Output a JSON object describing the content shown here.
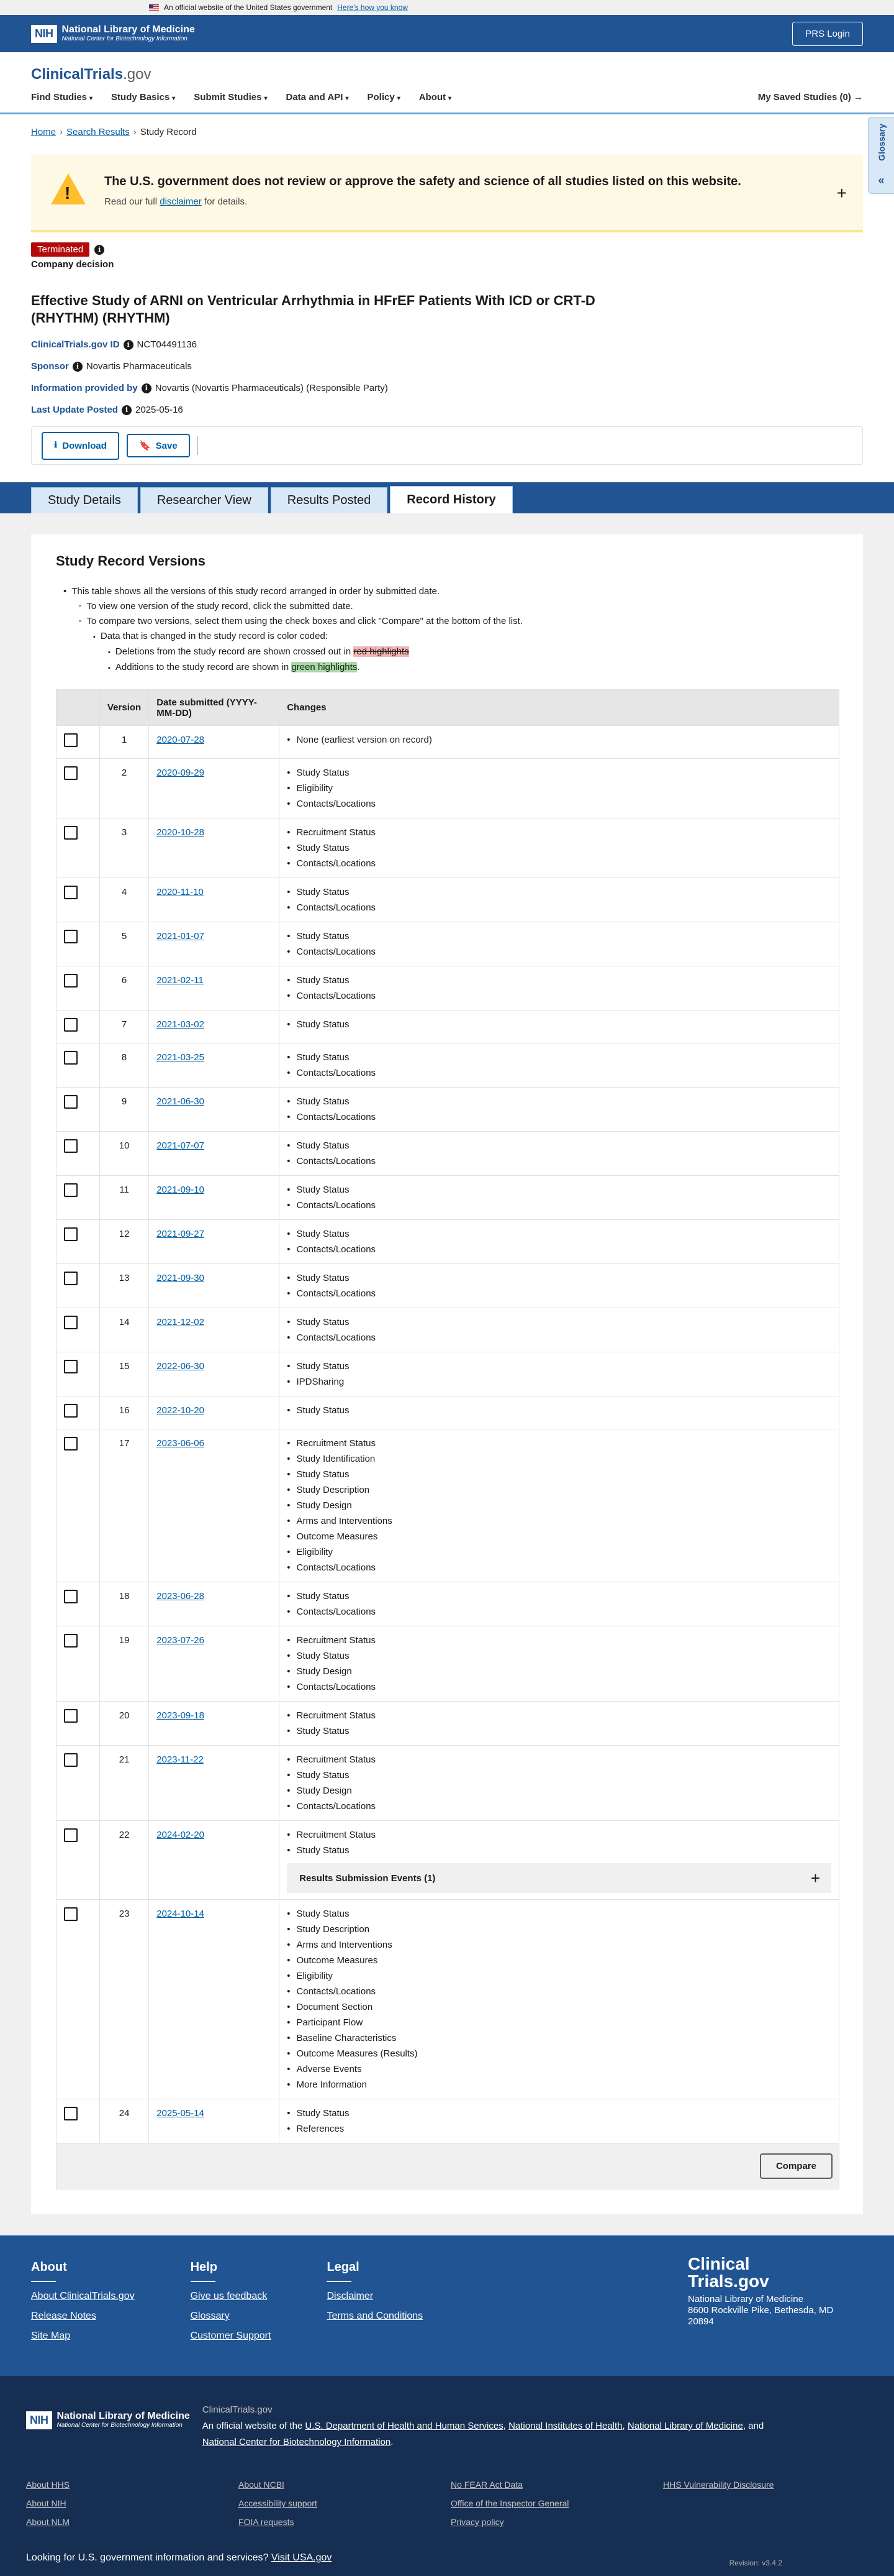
{
  "gov_banner": {
    "text": "An official website of the United States government",
    "link": "Here's how you know"
  },
  "nlm": {
    "nih_box": "NIH",
    "title": "National Library of Medicine",
    "subtitle": "National Center for Biotechnology Information",
    "prs_login": "PRS Login"
  },
  "site": {
    "logo_main": "ClinicalTrials",
    "logo_suffix": ".gov"
  },
  "nav": {
    "items": [
      "Find Studies",
      "Study Basics",
      "Submit Studies",
      "Data and API",
      "Policy",
      "About"
    ],
    "saved": "My Saved Studies (0) →"
  },
  "glossary": {
    "label": "Glossary"
  },
  "breadcrumb": {
    "home": "Home",
    "search": "Search Results",
    "current": "Study Record"
  },
  "alert": {
    "heading": "The U.S. government does not review or approve the safety and science of all studies listed on this website.",
    "pre": "Read our full",
    "link": "disclaimer",
    "post": "for details."
  },
  "status": {
    "badge": "Terminated",
    "company": "Company decision"
  },
  "study": {
    "title": "Effective Study of ARNI on Ventricular Arrhythmia in HFrEF Patients With ICD or CRT-D (RHYTHM) (RHYTHM)",
    "id_label": "ClinicalTrials.gov ID",
    "id_value": "NCT04491136",
    "sponsor_label": "Sponsor",
    "sponsor_value": "Novartis Pharmaceuticals",
    "info_label": "Information provided by",
    "info_value": "Novartis (Novartis Pharmaceuticals) (Responsible Party)",
    "update_label": "Last Update Posted",
    "update_value": "2025-05-16"
  },
  "actions": {
    "download": "Download",
    "save": "Save"
  },
  "tabs": [
    "Study Details",
    "Researcher View",
    "Results Posted",
    "Record History"
  ],
  "history": {
    "heading": "Study Record Versions",
    "i1": "This table shows all the versions of this study record arranged in order by submitted date.",
    "i2": "To view one version of the study record, click the submitted date.",
    "i3": "To compare two versions, select them using the check boxes and click \"Compare\" at the bottom of the list.",
    "i4": "Data that is changed in the study record is color coded:",
    "i5_pre": "Deletions from the study record are shown crossed out in",
    "i5_hl": "red highlights",
    "i6_pre": "Additions to the study record are shown in",
    "i6_hl": "green highlights",
    "col_version": "Version",
    "col_date": "Date submitted (YYYY-MM-DD)",
    "col_changes": "Changes",
    "rse_label": "Results Submission Events (1)",
    "compare": "Compare",
    "rows": [
      {
        "v": "1",
        "d": "2020-07-28",
        "c": [
          "None (earliest version on record)"
        ]
      },
      {
        "v": "2",
        "d": "2020-09-29",
        "c": [
          "Study Status",
          "Eligibility",
          "Contacts/Locations"
        ]
      },
      {
        "v": "3",
        "d": "2020-10-28",
        "c": [
          "Recruitment Status",
          "Study Status",
          "Contacts/Locations"
        ]
      },
      {
        "v": "4",
        "d": "2020-11-10",
        "c": [
          "Study Status",
          "Contacts/Locations"
        ]
      },
      {
        "v": "5",
        "d": "2021-01-07",
        "c": [
          "Study Status",
          "Contacts/Locations"
        ]
      },
      {
        "v": "6",
        "d": "2021-02-11",
        "c": [
          "Study Status",
          "Contacts/Locations"
        ]
      },
      {
        "v": "7",
        "d": "2021-03-02",
        "c": [
          "Study Status"
        ]
      },
      {
        "v": "8",
        "d": "2021-03-25",
        "c": [
          "Study Status",
          "Contacts/Locations"
        ]
      },
      {
        "v": "9",
        "d": "2021-06-30",
        "c": [
          "Study Status",
          "Contacts/Locations"
        ]
      },
      {
        "v": "10",
        "d": "2021-07-07",
        "c": [
          "Study Status",
          "Contacts/Locations"
        ]
      },
      {
        "v": "11",
        "d": "2021-09-10",
        "c": [
          "Study Status",
          "Contacts/Locations"
        ]
      },
      {
        "v": "12",
        "d": "2021-09-27",
        "c": [
          "Study Status",
          "Contacts/Locations"
        ]
      },
      {
        "v": "13",
        "d": "2021-09-30",
        "c": [
          "Study Status",
          "Contacts/Locations"
        ]
      },
      {
        "v": "14",
        "d": "2021-12-02",
        "c": [
          "Study Status",
          "Contacts/Locations"
        ]
      },
      {
        "v": "15",
        "d": "2022-06-30",
        "c": [
          "Study Status",
          "IPDSharing"
        ]
      },
      {
        "v": "16",
        "d": "2022-10-20",
        "c": [
          "Study Status"
        ]
      },
      {
        "v": "17",
        "d": "2023-06-06",
        "c": [
          "Recruitment Status",
          "Study Identification",
          "Study Status",
          "Study Description",
          "Study Design",
          "Arms and Interventions",
          "Outcome Measures",
          "Eligibility",
          "Contacts/Locations"
        ]
      },
      {
        "v": "18",
        "d": "2023-06-28",
        "c": [
          "Study Status",
          "Contacts/Locations"
        ]
      },
      {
        "v": "19",
        "d": "2023-07-26",
        "c": [
          "Recruitment Status",
          "Study Status",
          "Study Design",
          "Contacts/Locations"
        ]
      },
      {
        "v": "20",
        "d": "2023-09-18",
        "c": [
          "Recruitment Status",
          "Study Status"
        ]
      },
      {
        "v": "21",
        "d": "2023-11-22",
        "c": [
          "Recruitment Status",
          "Study Status",
          "Study Design",
          "Contacts/Locations"
        ]
      },
      {
        "v": "22",
        "d": "2024-02-20",
        "c": [
          "Recruitment Status",
          "Study Status"
        ],
        "rse": true
      },
      {
        "v": "23",
        "d": "2024-10-14",
        "c": [
          "Study Status",
          "Study Description",
          "Arms and Interventions",
          "Outcome Measures",
          "Eligibility",
          "Contacts/Locations",
          "Document Section",
          "Participant Flow",
          "Baseline Characteristics",
          "Outcome Measures (Results)",
          "Adverse Events",
          "More Information"
        ]
      },
      {
        "v": "24",
        "d": "2025-05-14",
        "c": [
          "Study Status",
          "References"
        ]
      }
    ]
  },
  "footer": {
    "about_h": "About",
    "about_links": [
      "About ClinicalTrials.gov",
      "Release Notes",
      "Site Map"
    ],
    "help_h": "Help",
    "help_links": [
      "Give us feedback",
      "Glossary",
      "Customer Support"
    ],
    "legal_h": "Legal",
    "legal_links": [
      "Disclaimer",
      "Terms and Conditions"
    ],
    "brand": "Clinical Trials.gov",
    "addr1": "National Library of Medicine",
    "addr2": "8600 Rockville Pike, Bethesda, MD 20894",
    "ct_label": "ClinicalTrials.gov",
    "official_pre": "An official website of the",
    "hhs": "U.S. Department of Health and Human Services",
    "nih": "National Institutes of Health",
    "nlm": "National Library of Medicine",
    "and": "and",
    "ncbi": "National Center for Biotechnology Information",
    "links": [
      "About HHS",
      "About NCBI",
      "No FEAR Act Data",
      "HHS Vulnerability Disclosure",
      "About NIH",
      "Accessibility support",
      "Office of the Inspector General",
      "",
      "About NLM",
      "FOIA requests",
      "Privacy policy",
      ""
    ],
    "usa_pre": "Looking for U.S. government information and services?",
    "usa_link": "Visit USA.gov",
    "revision": "Revision: v3.4.2"
  }
}
